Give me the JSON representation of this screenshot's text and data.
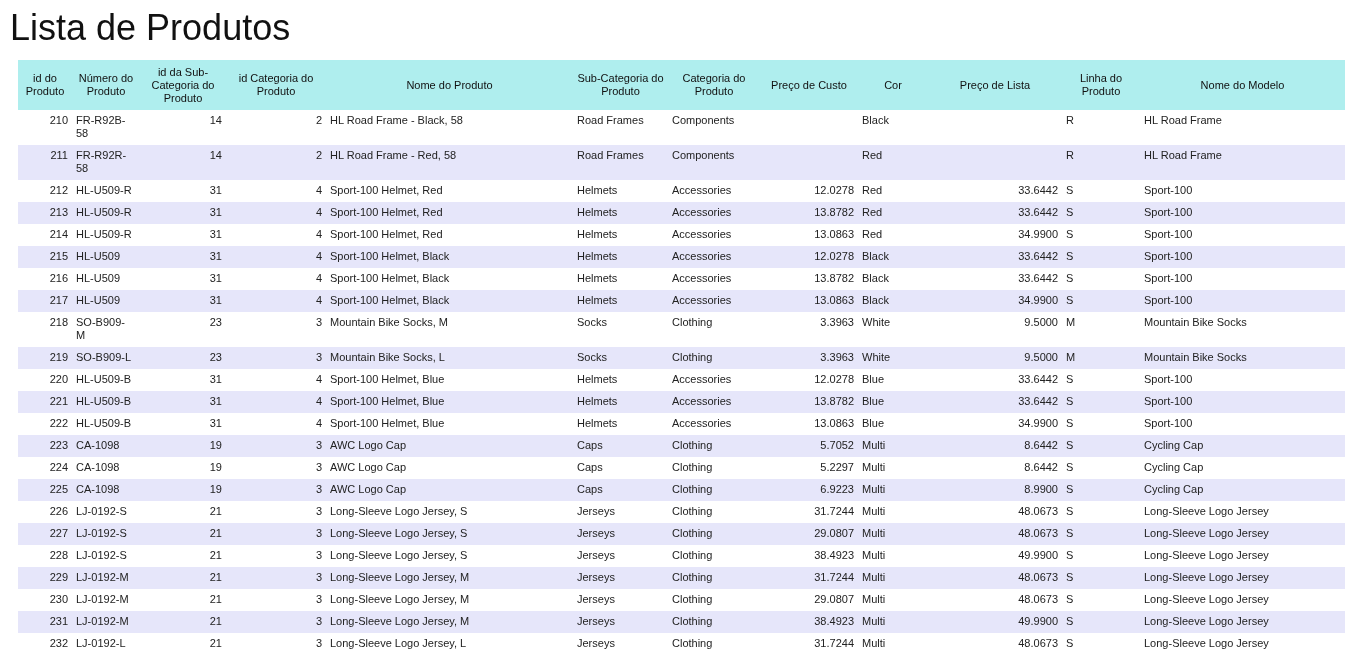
{
  "title": "Lista de Produtos",
  "table": {
    "columns": [
      "id do Produto",
      "Número do Produto",
      "id da Sub-Categoria do Produto",
      "id Categoria do Produto",
      "Nome do Produto",
      "Sub-Categoria do Produto",
      "Categoria do Produto",
      "Preço de Custo",
      "Cor",
      "Preço de Lista",
      "Linha do Produto",
      "Nome do Modelo"
    ],
    "rows": [
      {
        "id": "210",
        "number": "FR-R92B-58",
        "subcat_id": "14",
        "cat_id": "2",
        "name": "HL Road Frame - Black, 58",
        "subcategory": "Road Frames",
        "category": "Components",
        "cor": "Black",
        "line": "R",
        "model": "HL Road Frame"
      },
      {
        "id": "211",
        "number": "FR-R92R-58",
        "subcat_id": "14",
        "cat_id": "2",
        "name": "HL Road Frame - Red, 58",
        "subcategory": "Road Frames",
        "category": "Components",
        "cor": "Red",
        "line": "R",
        "model": "HL Road Frame"
      },
      {
        "id": "212",
        "number": "HL-U509-R",
        "subcat_id": "31",
        "cat_id": "4",
        "name": "Sport-100 Helmet, Red",
        "subcategory": "Helmets",
        "category": "Accessories",
        "cost": "12.0278",
        "cor": "Red",
        "list_price": "33.6442",
        "line": "S",
        "model": "Sport-100"
      },
      {
        "id": "213",
        "number": "HL-U509-R",
        "subcat_id": "31",
        "cat_id": "4",
        "name": "Sport-100 Helmet, Red",
        "subcategory": "Helmets",
        "category": "Accessories",
        "cost": "13.8782",
        "cor": "Red",
        "list_price": "33.6442",
        "line": "S",
        "model": "Sport-100"
      },
      {
        "id": "214",
        "number": "HL-U509-R",
        "subcat_id": "31",
        "cat_id": "4",
        "name": "Sport-100 Helmet, Red",
        "subcategory": "Helmets",
        "category": "Accessories",
        "cost": "13.0863",
        "cor": "Red",
        "list_price": "34.9900",
        "line": "S",
        "model": "Sport-100"
      },
      {
        "id": "215",
        "number": "HL-U509",
        "subcat_id": "31",
        "cat_id": "4",
        "name": "Sport-100 Helmet, Black",
        "subcategory": "Helmets",
        "category": "Accessories",
        "cost": "12.0278",
        "cor": "Black",
        "list_price": "33.6442",
        "line": "S",
        "model": "Sport-100"
      },
      {
        "id": "216",
        "number": "HL-U509",
        "subcat_id": "31",
        "cat_id": "4",
        "name": "Sport-100 Helmet, Black",
        "subcategory": "Helmets",
        "category": "Accessories",
        "cost": "13.8782",
        "cor": "Black",
        "list_price": "33.6442",
        "line": "S",
        "model": "Sport-100"
      },
      {
        "id": "217",
        "number": "HL-U509",
        "subcat_id": "31",
        "cat_id": "4",
        "name": "Sport-100 Helmet, Black",
        "subcategory": "Helmets",
        "category": "Accessories",
        "cost": "13.0863",
        "cor": "Black",
        "list_price": "34.9900",
        "line": "S",
        "model": "Sport-100"
      },
      {
        "id": "218",
        "number": "SO-B909-M",
        "subcat_id": "23",
        "cat_id": "3",
        "name": "Mountain Bike Socks, M",
        "subcategory": "Socks",
        "category": "Clothing",
        "cost": "3.3963",
        "cor": "White",
        "list_price": "9.5000",
        "line": "M",
        "model": "Mountain Bike Socks"
      },
      {
        "id": "219",
        "number": "SO-B909-L",
        "subcat_id": "23",
        "cat_id": "3",
        "name": "Mountain Bike Socks, L",
        "subcategory": "Socks",
        "category": "Clothing",
        "cost": "3.3963",
        "cor": "White",
        "list_price": "9.5000",
        "line": "M",
        "model": "Mountain Bike Socks"
      },
      {
        "id": "220",
        "number": "HL-U509-B",
        "subcat_id": "31",
        "cat_id": "4",
        "name": "Sport-100 Helmet, Blue",
        "subcategory": "Helmets",
        "category": "Accessories",
        "cost": "12.0278",
        "cor": "Blue",
        "list_price": "33.6442",
        "line": "S",
        "model": "Sport-100"
      },
      {
        "id": "221",
        "number": "HL-U509-B",
        "subcat_id": "31",
        "cat_id": "4",
        "name": "Sport-100 Helmet, Blue",
        "subcategory": "Helmets",
        "category": "Accessories",
        "cost": "13.8782",
        "cor": "Blue",
        "list_price": "33.6442",
        "line": "S",
        "model": "Sport-100"
      },
      {
        "id": "222",
        "number": "HL-U509-B",
        "subcat_id": "31",
        "cat_id": "4",
        "name": "Sport-100 Helmet, Blue",
        "subcategory": "Helmets",
        "category": "Accessories",
        "cost": "13.0863",
        "cor": "Blue",
        "list_price": "34.9900",
        "line": "S",
        "model": "Sport-100"
      },
      {
        "id": "223",
        "number": "CA-1098",
        "subcat_id": "19",
        "cat_id": "3",
        "name": "AWC Logo Cap",
        "subcategory": "Caps",
        "category": "Clothing",
        "cost": "5.7052",
        "cor": "Multi",
        "list_price": "8.6442",
        "line": "S",
        "model": "Cycling Cap"
      },
      {
        "id": "224",
        "number": "CA-1098",
        "subcat_id": "19",
        "cat_id": "3",
        "name": "AWC Logo Cap",
        "subcategory": "Caps",
        "category": "Clothing",
        "cost": "5.2297",
        "cor": "Multi",
        "list_price": "8.6442",
        "line": "S",
        "model": "Cycling Cap"
      },
      {
        "id": "225",
        "number": "CA-1098",
        "subcat_id": "19",
        "cat_id": "3",
        "name": "AWC Logo Cap",
        "subcategory": "Caps",
        "category": "Clothing",
        "cost": "6.9223",
        "cor": "Multi",
        "list_price": "8.9900",
        "line": "S",
        "model": "Cycling Cap"
      },
      {
        "id": "226",
        "number": "LJ-0192-S",
        "subcat_id": "21",
        "cat_id": "3",
        "name": "Long-Sleeve Logo Jersey, S",
        "subcategory": "Jerseys",
        "category": "Clothing",
        "cost": "31.7244",
        "cor": "Multi",
        "list_price": "48.0673",
        "line": "S",
        "model": "Long-Sleeve Logo Jersey"
      },
      {
        "id": "227",
        "number": "LJ-0192-S",
        "subcat_id": "21",
        "cat_id": "3",
        "name": "Long-Sleeve Logo Jersey, S",
        "subcategory": "Jerseys",
        "category": "Clothing",
        "cost": "29.0807",
        "cor": "Multi",
        "list_price": "48.0673",
        "line": "S",
        "model": "Long-Sleeve Logo Jersey"
      },
      {
        "id": "228",
        "number": "LJ-0192-S",
        "subcat_id": "21",
        "cat_id": "3",
        "name": "Long-Sleeve Logo Jersey, S",
        "subcategory": "Jerseys",
        "category": "Clothing",
        "cost": "38.4923",
        "cor": "Multi",
        "list_price": "49.9900",
        "line": "S",
        "model": "Long-Sleeve Logo Jersey"
      },
      {
        "id": "229",
        "number": "LJ-0192-M",
        "subcat_id": "21",
        "cat_id": "3",
        "name": "Long-Sleeve Logo Jersey, M",
        "subcategory": "Jerseys",
        "category": "Clothing",
        "cost": "31.7244",
        "cor": "Multi",
        "list_price": "48.0673",
        "line": "S",
        "model": "Long-Sleeve Logo Jersey"
      },
      {
        "id": "230",
        "number": "LJ-0192-M",
        "subcat_id": "21",
        "cat_id": "3",
        "name": "Long-Sleeve Logo Jersey, M",
        "subcategory": "Jerseys",
        "category": "Clothing",
        "cost": "29.0807",
        "cor": "Multi",
        "list_price": "48.0673",
        "line": "S",
        "model": "Long-Sleeve Logo Jersey"
      },
      {
        "id": "231",
        "number": "LJ-0192-M",
        "subcat_id": "21",
        "cat_id": "3",
        "name": "Long-Sleeve Logo Jersey, M",
        "subcategory": "Jerseys",
        "category": "Clothing",
        "cost": "38.4923",
        "cor": "Multi",
        "list_price": "49.9900",
        "line": "S",
        "model": "Long-Sleeve Logo Jersey"
      },
      {
        "id": "232",
        "number": "LJ-0192-L",
        "subcat_id": "21",
        "cat_id": "3",
        "name": "Long-Sleeve Logo Jersey, L",
        "subcategory": "Jerseys",
        "category": "Clothing",
        "cost": "31.7244",
        "cor": "Multi",
        "list_price": "48.0673",
        "line": "S",
        "model": "Long-Sleeve Logo Jersey"
      }
    ]
  }
}
